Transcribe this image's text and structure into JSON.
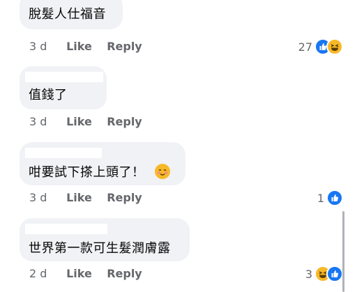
{
  "comments": [
    {
      "text": "脫髮人仕福音",
      "time": "3 d",
      "like": "Like",
      "reply": "Reply",
      "reaction_count": "27",
      "reactions": [
        "like-icon",
        "haha-icon"
      ]
    },
    {
      "text": "值錢了",
      "time": "3 d",
      "like": "Like",
      "reply": "Reply"
    },
    {
      "text": "咁要試下搽上頭了！",
      "trailing_emoji": "blushing-smile-emoji",
      "time": "3 d",
      "like": "Like",
      "reply": "Reply",
      "reaction_count": "1",
      "reactions": [
        "like-icon"
      ]
    },
    {
      "text": "世界第一款可生髮潤膚露",
      "time": "2 d",
      "like": "Like",
      "reply": "Reply",
      "reaction_count": "3",
      "reactions": [
        "haha-icon",
        "like-icon"
      ]
    }
  ],
  "colors": {
    "bubble": "#f0f2f5",
    "meta_text": "#65676b",
    "like_blue": "#1877f2",
    "haha_yellow": "#f7b928"
  }
}
